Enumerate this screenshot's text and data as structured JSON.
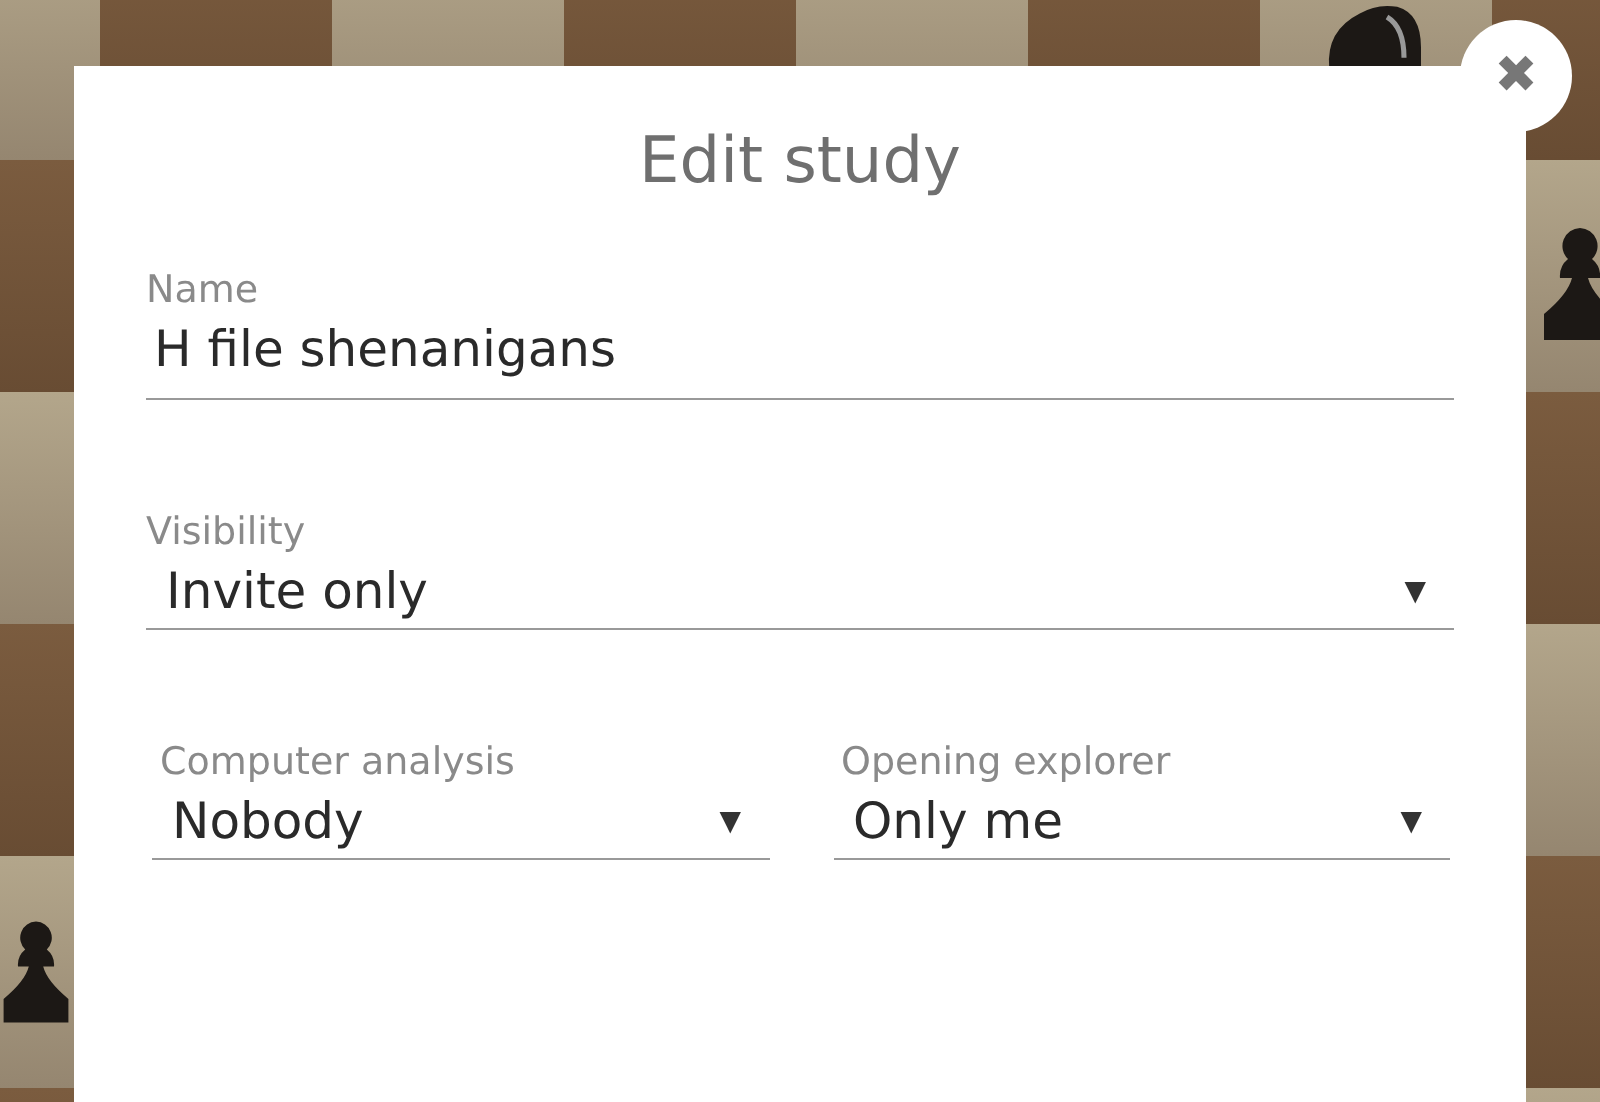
{
  "dialog": {
    "title": "Edit study",
    "close_label": "✖"
  },
  "fields": [
    {
      "kind": "text",
      "label": "Name",
      "value": "H file shenanigans"
    },
    {
      "kind": "select",
      "label": "Visibility",
      "value": "Invite only",
      "caret": "▼"
    }
  ],
  "field_pair": [
    {
      "kind": "select",
      "label": "Computer analysis",
      "value": "Nobody",
      "caret": "▼"
    },
    {
      "kind": "select",
      "label": "Opening explorer",
      "value": "Only me",
      "caret": "▼"
    }
  ]
}
